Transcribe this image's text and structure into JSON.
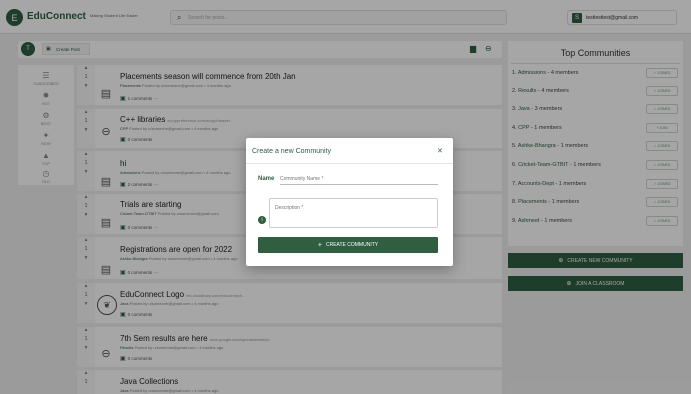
{
  "header": {
    "logo_initial": "E",
    "brand": "EduConnect",
    "tagline": "Making Student Life Easier",
    "search_placeholder": "Search for posts...",
    "user_initial": "S",
    "user_email": "testtesttest@gmail.com"
  },
  "postbar": {
    "avatar_initial": "T",
    "create_post_label": "Create Post"
  },
  "sidebar": {
    "items": [
      {
        "label": "SUBSCRIBED",
        "icon": "subscribed-icon"
      },
      {
        "label": "HOT",
        "icon": "fire-icon"
      },
      {
        "label": "BEST",
        "icon": "best-icon"
      },
      {
        "label": "NEW",
        "icon": "new-icon"
      },
      {
        "label": "TOP",
        "icon": "top-icon"
      },
      {
        "label": "OLD",
        "icon": "old-icon"
      }
    ]
  },
  "posts": [
    {
      "votes": "1",
      "title": "Placements season will commence from 20th Jan",
      "link": "",
      "community": "Placements",
      "meta": "Posted by u/someone@gmail.com • 4 months ago",
      "comments": "1 comments",
      "thumb": "text-icon"
    },
    {
      "votes": "1",
      "title": "C++ libraries",
      "link": "en.cppreference.com/w/cpp/header",
      "community": "CPP",
      "meta": "Posted by u/someone@gmail.com • 4 months ago",
      "comments": "0 comments",
      "thumb": "link-icon"
    },
    {
      "votes": "1",
      "title": "hi",
      "link": "",
      "community": "Admissions",
      "meta": "Posted by u/someone@gmail.com • 4 months ago",
      "comments": "2 comments",
      "thumb": "text-icon"
    },
    {
      "votes": "1",
      "title": "Trials are starting",
      "link": "",
      "community": "Cricket-Team-GTBIT",
      "meta": "Posted by u/someone@gmail.com",
      "comments": "0 comments",
      "thumb": "text-icon"
    },
    {
      "votes": "1",
      "title": "Registrations are open for 2022",
      "link": "",
      "community": "Ashke-Bhangra",
      "meta": "Posted by u/someone@gmail.com • 4 months ago",
      "comments": "0 comments",
      "thumb": "text-icon"
    },
    {
      "votes": "1",
      "title": "EduConnect Logo",
      "link": "res.cloudinary.com/educonnect/...",
      "community": "Java",
      "meta": "Posted by u/someone@gmail.com • 4 months ago",
      "comments": "0 comments",
      "thumb": "logo-image"
    },
    {
      "votes": "1",
      "title": "7th Sem results are here",
      "link": "docs.google.com/spreadsheets/d/...",
      "community": "Results",
      "meta": "Posted by u/someone@gmail.com • 4 months ago",
      "comments": "0 comments",
      "thumb": "link-icon"
    },
    {
      "votes": "1",
      "title": "Java Collections",
      "link": "",
      "community": "Java",
      "meta": "Posted by u/someone@gmail.com • 4 months ago",
      "comments": "",
      "thumb": "text-icon"
    }
  ],
  "top_communities": {
    "title": "Top Communities",
    "items": [
      {
        "rank": "1.",
        "name": "Admissions",
        "count": " - 4 members",
        "button": "✓ JOINED"
      },
      {
        "rank": "2.",
        "name": "Results",
        "count": " - 4 members",
        "button": "✓ JOINED"
      },
      {
        "rank": "3.",
        "name": "Java",
        "count": " - 3 members",
        "button": "✓ JOINED"
      },
      {
        "rank": "4.",
        "name": "CPP",
        "count": " - 1 members",
        "button": "+ JOIN"
      },
      {
        "rank": "5.",
        "name": "Ashke-Bhangra",
        "count": " - 1 members",
        "button": "✓ JOINED"
      },
      {
        "rank": "6.",
        "name": "Cricket-Team-GTBIT",
        "count": " - 1 members",
        "button": "✓ JOINED"
      },
      {
        "rank": "7.",
        "name": "Accounts-Dept",
        "count": " - 1 members",
        "button": "✓ JOINED"
      },
      {
        "rank": "8.",
        "name": "Placements",
        "count": " - 1 members",
        "button": "✓ JOINED"
      },
      {
        "rank": "9.",
        "name": "Ashmeet",
        "count": " - 1 members",
        "button": "✓ JOINED"
      }
    ],
    "create_button": "CREATE NEW COMMUNITY",
    "join_classroom_button": "JOIN A CLASSROOM"
  },
  "modal": {
    "title": "Create a new Community",
    "close": "✕",
    "name_label": "Name",
    "name_placeholder": "Community Name *",
    "description_placeholder": "Description *",
    "info": "i",
    "create_button": "CREATE COMMUNITY",
    "create_plus": "+"
  },
  "colors": {
    "primary": "#2f5e41",
    "background": "#efefef",
    "overlay": "rgba(0,0,0,0.35)"
  }
}
